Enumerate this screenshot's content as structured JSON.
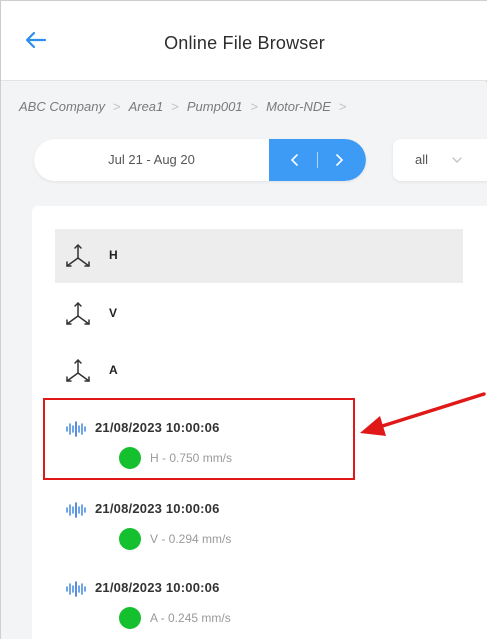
{
  "header": {
    "title": "Online File Browser",
    "back_icon": "arrow-left-icon"
  },
  "breadcrumb": [
    "ABC Company",
    "Area1",
    "Pump001",
    "Motor-NDE"
  ],
  "date_range": {
    "label": "Jul 21 - Aug 20",
    "prev_icon": "chevron-left-icon",
    "next_icon": "chevron-right-icon",
    "accent_color": "#3d9bf5"
  },
  "filter": {
    "value": "all",
    "icon": "chevron-down-icon"
  },
  "axes": [
    {
      "label": "H",
      "selected": true
    },
    {
      "label": "V",
      "selected": false
    },
    {
      "label": "A",
      "selected": false
    }
  ],
  "records": [
    {
      "timestamp": "21/08/2023 10:00:06",
      "value": "H - 0.750 mm/s",
      "status_color": "#15c02f",
      "highlighted": true
    },
    {
      "timestamp": "21/08/2023 10:00:06",
      "value": "V - 0.294 mm/s",
      "status_color": "#15c02f",
      "highlighted": false
    },
    {
      "timestamp": "21/08/2023 10:00:06",
      "value": "A - 0.245 mm/s",
      "status_color": "#15c02f",
      "highlighted": false
    }
  ],
  "annotation": {
    "color": "#e01818"
  }
}
